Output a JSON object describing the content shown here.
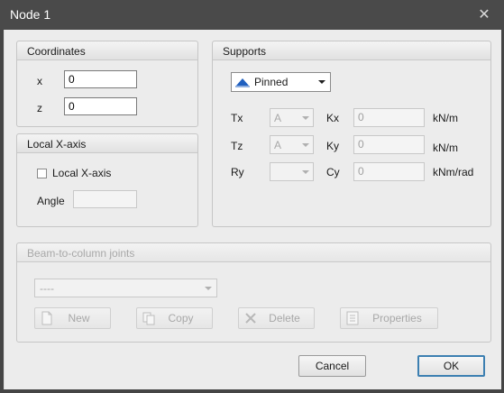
{
  "window": {
    "title": "Node 1",
    "close_symbol": "✕"
  },
  "coordinates": {
    "title": "Coordinates",
    "x_label": "x",
    "x_value": "0",
    "z_label": "z",
    "z_value": "0"
  },
  "local_axis": {
    "title": "Local X-axis",
    "checkbox_label": "Local X-axis",
    "angle_label": "Angle",
    "angle_value": ""
  },
  "supports": {
    "title": "Supports",
    "type_selected": "Pinned",
    "rows": [
      {
        "label": "Tx",
        "combo": "A",
        "k_label": "Kx",
        "k_value": "0",
        "unit": "kN/m"
      },
      {
        "label": "Tz",
        "combo": "A",
        "k_label": "Ky",
        "k_value": "0",
        "unit": "kN/m"
      },
      {
        "label": "Ry",
        "combo": "",
        "k_label": "Cy",
        "k_value": "0",
        "unit": "kNm/rad"
      }
    ]
  },
  "joints": {
    "title": "Beam-to-column joints",
    "selected": "----",
    "buttons": {
      "new": "New",
      "copy": "Copy",
      "delete": "Delete",
      "properties": "Properties"
    }
  },
  "footer": {
    "cancel": "Cancel",
    "ok": "OK"
  },
  "colors": {
    "accent": "#3c7fb1",
    "title_bar": "#4a4a4a",
    "client_bg": "#ececec",
    "pinned_icon": "#1f5fbf"
  }
}
